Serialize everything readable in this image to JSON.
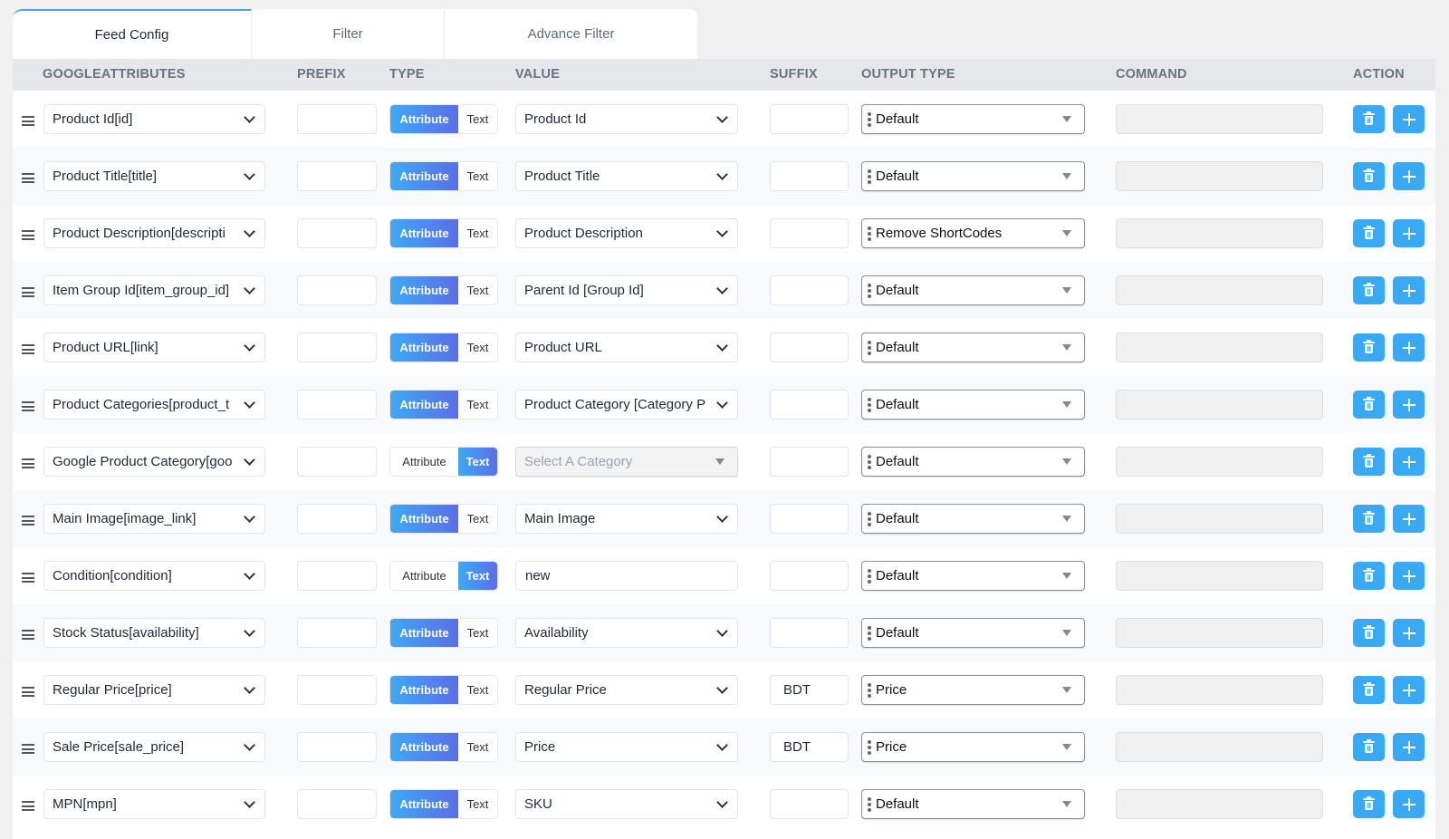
{
  "tabs": [
    {
      "label": "Feed Config",
      "active": true
    },
    {
      "label": "Filter",
      "active": false
    },
    {
      "label": "Advance Filter",
      "active": false
    }
  ],
  "columns": {
    "attributes": "GOOGLEATTRIBUTES",
    "prefix": "PREFIX",
    "type": "TYPE",
    "value": "VALUE",
    "suffix": "SUFFIX",
    "output_type": "OUTPUT TYPE",
    "command": "COMMAND",
    "action": "ACTION"
  },
  "type_labels": {
    "attribute": "Attribute",
    "text": "Text"
  },
  "colors": {
    "accent": "#3aa9f4",
    "gradient_start": "#3ea9f5",
    "gradient_end": "#5b6ee8"
  },
  "rows": [
    {
      "attribute": "Product Id[id]",
      "prefix": "",
      "type": "Attribute",
      "value": "Product Id",
      "value_kind": "select",
      "suffix": "",
      "output_type": "Default",
      "command": ""
    },
    {
      "attribute": "Product Title[title]",
      "prefix": "",
      "type": "Attribute",
      "value": "Product Title",
      "value_kind": "select",
      "suffix": "",
      "output_type": "Default",
      "command": ""
    },
    {
      "attribute": "Product Description[descripti",
      "prefix": "",
      "type": "Attribute",
      "value": "Product Description",
      "value_kind": "select",
      "suffix": "",
      "output_type": "Remove ShortCodes",
      "command": ""
    },
    {
      "attribute": "Item Group Id[item_group_id]",
      "prefix": "",
      "type": "Attribute",
      "value": "Parent Id [Group Id]",
      "value_kind": "select",
      "suffix": "",
      "output_type": "Default",
      "command": ""
    },
    {
      "attribute": "Product URL[link]",
      "prefix": "",
      "type": "Attribute",
      "value": "Product URL",
      "value_kind": "select",
      "suffix": "",
      "output_type": "Default",
      "command": ""
    },
    {
      "attribute": "Product Categories[product_t",
      "prefix": "",
      "type": "Attribute",
      "value": "Product Category [Category P",
      "value_kind": "select",
      "suffix": "",
      "output_type": "Default",
      "command": ""
    },
    {
      "attribute": "Google Product Category[goo",
      "prefix": "",
      "type": "Text",
      "value": "Select A Category",
      "value_kind": "disabled-select",
      "suffix": "",
      "output_type": "Default",
      "command": ""
    },
    {
      "attribute": "Main Image[image_link]",
      "prefix": "",
      "type": "Attribute",
      "value": "Main Image",
      "value_kind": "select",
      "suffix": "",
      "output_type": "Default",
      "command": ""
    },
    {
      "attribute": "Condition[condition]",
      "prefix": "",
      "type": "Text",
      "value": "new",
      "value_kind": "text",
      "suffix": "",
      "output_type": "Default",
      "command": ""
    },
    {
      "attribute": "Stock Status[availability]",
      "prefix": "",
      "type": "Attribute",
      "value": "Availability",
      "value_kind": "select",
      "suffix": "",
      "output_type": "Default",
      "command": ""
    },
    {
      "attribute": "Regular Price[price]",
      "prefix": "",
      "type": "Attribute",
      "value": "Regular Price",
      "value_kind": "select",
      "suffix": "BDT",
      "output_type": "Price",
      "command": ""
    },
    {
      "attribute": "Sale Price[sale_price]",
      "prefix": "",
      "type": "Attribute",
      "value": "Price",
      "value_kind": "select",
      "suffix": "BDT",
      "output_type": "Price",
      "command": ""
    },
    {
      "attribute": "MPN[mpn]",
      "prefix": "",
      "type": "Attribute",
      "value": "SKU",
      "value_kind": "select",
      "suffix": "",
      "output_type": "Default",
      "command": ""
    }
  ]
}
